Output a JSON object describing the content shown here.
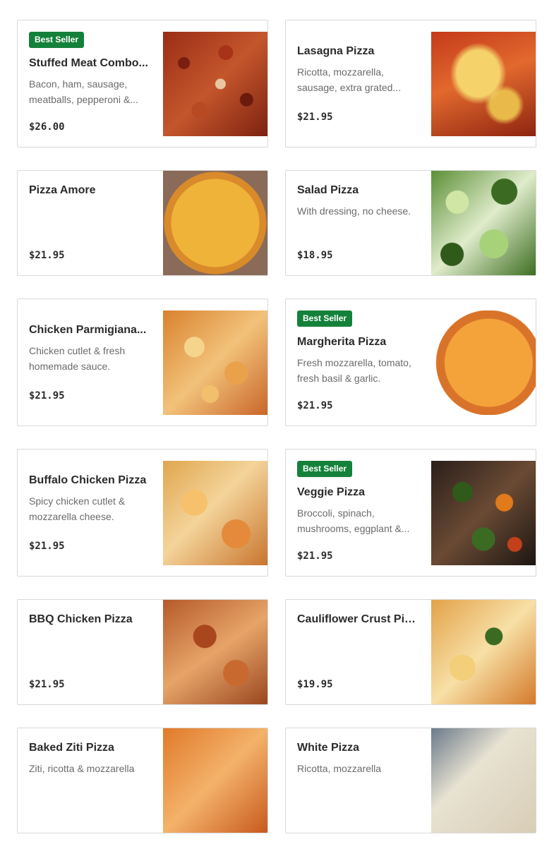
{
  "badge_label": "Best Seller",
  "colors": {
    "badge_bg": "#14813a",
    "border": "#d9d9d9"
  },
  "items": [
    {
      "name": "Stuffed Meat Combo...",
      "best_seller": true,
      "desc": "Bacon, ham, sausage, meatballs, pepperoni &...",
      "price": "$26.00",
      "image": "meat-combo-pizza-photo"
    },
    {
      "name": "Lasagna Pizza",
      "best_seller": false,
      "desc": "Ricotta, mozzarella, sausage, extra grated...",
      "price": "$21.95",
      "image": "lasagna-pizza-photo"
    },
    {
      "name": "Pizza Amore",
      "best_seller": false,
      "desc": "",
      "price": "$21.95",
      "image": "pizza-amore-photo"
    },
    {
      "name": "Salad Pizza",
      "best_seller": false,
      "desc": "With dressing, no cheese.",
      "price": "$18.95",
      "image": "salad-pizza-photo"
    },
    {
      "name": "Chicken Parmigiana...",
      "best_seller": false,
      "desc": "Chicken cutlet & fresh homemade sauce.",
      "price": "$21.95",
      "image": "chicken-parm-pizza-photo"
    },
    {
      "name": "Margherita Pizza",
      "best_seller": true,
      "desc": "Fresh mozzarella, tomato, fresh basil & garlic.",
      "price": "$21.95",
      "image": "margherita-pizza-photo"
    },
    {
      "name": "Buffalo Chicken Pizza",
      "best_seller": false,
      "desc": "Spicy chicken cutlet & mozzarella cheese.",
      "price": "$21.95",
      "image": "buffalo-chicken-pizza-photo"
    },
    {
      "name": "Veggie Pizza",
      "best_seller": true,
      "desc": "Broccoli, spinach, mushrooms, eggplant &...",
      "price": "$21.95",
      "image": "veggie-pizza-photo"
    },
    {
      "name": "BBQ Chicken Pizza",
      "best_seller": false,
      "desc": "",
      "price": "$21.95",
      "image": "bbq-chicken-pizza-photo"
    },
    {
      "name": "Cauliflower Crust Pizza",
      "best_seller": false,
      "desc": "",
      "price": "$19.95",
      "image": "cauliflower-crust-pizza-photo"
    },
    {
      "name": "Baked Ziti Pizza",
      "best_seller": false,
      "desc": "Ziti, ricotta & mozzarella",
      "price": "",
      "image": "baked-ziti-pizza-photo"
    },
    {
      "name": "White Pizza",
      "best_seller": false,
      "desc": "Ricotta, mozzarella",
      "price": "",
      "image": "white-pizza-photo"
    }
  ]
}
